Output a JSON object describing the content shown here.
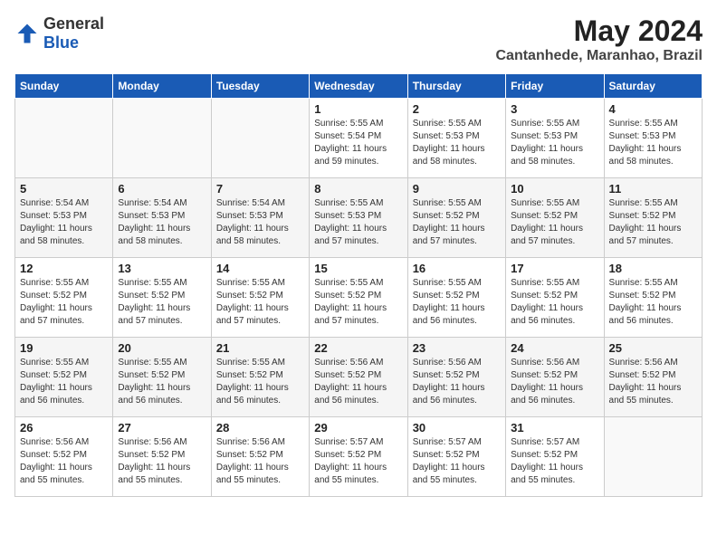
{
  "logo": {
    "general": "General",
    "blue": "Blue"
  },
  "title": {
    "month": "May 2024",
    "location": "Cantanhede, Maranhao, Brazil"
  },
  "headers": [
    "Sunday",
    "Monday",
    "Tuesday",
    "Wednesday",
    "Thursday",
    "Friday",
    "Saturday"
  ],
  "weeks": [
    [
      {
        "day": "",
        "info": ""
      },
      {
        "day": "",
        "info": ""
      },
      {
        "day": "",
        "info": ""
      },
      {
        "day": "1",
        "info": "Sunrise: 5:55 AM\nSunset: 5:54 PM\nDaylight: 11 hours\nand 59 minutes."
      },
      {
        "day": "2",
        "info": "Sunrise: 5:55 AM\nSunset: 5:53 PM\nDaylight: 11 hours\nand 58 minutes."
      },
      {
        "day": "3",
        "info": "Sunrise: 5:55 AM\nSunset: 5:53 PM\nDaylight: 11 hours\nand 58 minutes."
      },
      {
        "day": "4",
        "info": "Sunrise: 5:55 AM\nSunset: 5:53 PM\nDaylight: 11 hours\nand 58 minutes."
      }
    ],
    [
      {
        "day": "5",
        "info": "Sunrise: 5:54 AM\nSunset: 5:53 PM\nDaylight: 11 hours\nand 58 minutes."
      },
      {
        "day": "6",
        "info": "Sunrise: 5:54 AM\nSunset: 5:53 PM\nDaylight: 11 hours\nand 58 minutes."
      },
      {
        "day": "7",
        "info": "Sunrise: 5:54 AM\nSunset: 5:53 PM\nDaylight: 11 hours\nand 58 minutes."
      },
      {
        "day": "8",
        "info": "Sunrise: 5:55 AM\nSunset: 5:53 PM\nDaylight: 11 hours\nand 57 minutes."
      },
      {
        "day": "9",
        "info": "Sunrise: 5:55 AM\nSunset: 5:52 PM\nDaylight: 11 hours\nand 57 minutes."
      },
      {
        "day": "10",
        "info": "Sunrise: 5:55 AM\nSunset: 5:52 PM\nDaylight: 11 hours\nand 57 minutes."
      },
      {
        "day": "11",
        "info": "Sunrise: 5:55 AM\nSunset: 5:52 PM\nDaylight: 11 hours\nand 57 minutes."
      }
    ],
    [
      {
        "day": "12",
        "info": "Sunrise: 5:55 AM\nSunset: 5:52 PM\nDaylight: 11 hours\nand 57 minutes."
      },
      {
        "day": "13",
        "info": "Sunrise: 5:55 AM\nSunset: 5:52 PM\nDaylight: 11 hours\nand 57 minutes."
      },
      {
        "day": "14",
        "info": "Sunrise: 5:55 AM\nSunset: 5:52 PM\nDaylight: 11 hours\nand 57 minutes."
      },
      {
        "day": "15",
        "info": "Sunrise: 5:55 AM\nSunset: 5:52 PM\nDaylight: 11 hours\nand 57 minutes."
      },
      {
        "day": "16",
        "info": "Sunrise: 5:55 AM\nSunset: 5:52 PM\nDaylight: 11 hours\nand 56 minutes."
      },
      {
        "day": "17",
        "info": "Sunrise: 5:55 AM\nSunset: 5:52 PM\nDaylight: 11 hours\nand 56 minutes."
      },
      {
        "day": "18",
        "info": "Sunrise: 5:55 AM\nSunset: 5:52 PM\nDaylight: 11 hours\nand 56 minutes."
      }
    ],
    [
      {
        "day": "19",
        "info": "Sunrise: 5:55 AM\nSunset: 5:52 PM\nDaylight: 11 hours\nand 56 minutes."
      },
      {
        "day": "20",
        "info": "Sunrise: 5:55 AM\nSunset: 5:52 PM\nDaylight: 11 hours\nand 56 minutes."
      },
      {
        "day": "21",
        "info": "Sunrise: 5:55 AM\nSunset: 5:52 PM\nDaylight: 11 hours\nand 56 minutes."
      },
      {
        "day": "22",
        "info": "Sunrise: 5:56 AM\nSunset: 5:52 PM\nDaylight: 11 hours\nand 56 minutes."
      },
      {
        "day": "23",
        "info": "Sunrise: 5:56 AM\nSunset: 5:52 PM\nDaylight: 11 hours\nand 56 minutes."
      },
      {
        "day": "24",
        "info": "Sunrise: 5:56 AM\nSunset: 5:52 PM\nDaylight: 11 hours\nand 56 minutes."
      },
      {
        "day": "25",
        "info": "Sunrise: 5:56 AM\nSunset: 5:52 PM\nDaylight: 11 hours\nand 55 minutes."
      }
    ],
    [
      {
        "day": "26",
        "info": "Sunrise: 5:56 AM\nSunset: 5:52 PM\nDaylight: 11 hours\nand 55 minutes."
      },
      {
        "day": "27",
        "info": "Sunrise: 5:56 AM\nSunset: 5:52 PM\nDaylight: 11 hours\nand 55 minutes."
      },
      {
        "day": "28",
        "info": "Sunrise: 5:56 AM\nSunset: 5:52 PM\nDaylight: 11 hours\nand 55 minutes."
      },
      {
        "day": "29",
        "info": "Sunrise: 5:57 AM\nSunset: 5:52 PM\nDaylight: 11 hours\nand 55 minutes."
      },
      {
        "day": "30",
        "info": "Sunrise: 5:57 AM\nSunset: 5:52 PM\nDaylight: 11 hours\nand 55 minutes."
      },
      {
        "day": "31",
        "info": "Sunrise: 5:57 AM\nSunset: 5:52 PM\nDaylight: 11 hours\nand 55 minutes."
      },
      {
        "day": "",
        "info": ""
      }
    ]
  ]
}
